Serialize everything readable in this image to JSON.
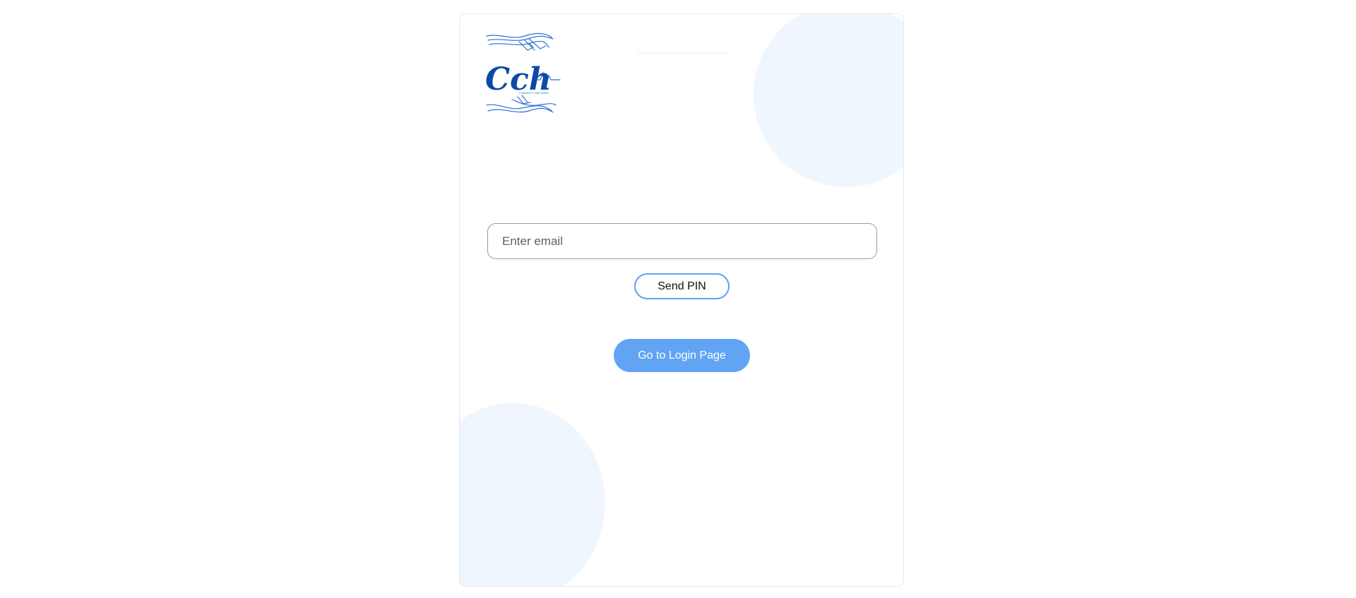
{
  "logo": {
    "text": "Cch",
    "tagline": "COMMUNITY CARE HOMES",
    "color": "#0d49a6",
    "line_color": "#2c6fd6"
  },
  "email": {
    "placeholder": "Enter email",
    "value": ""
  },
  "buttons": {
    "send_pin": "Send PIN",
    "go_to_login": "Go to Login Page"
  },
  "colors": {
    "accent": "#62a4f4",
    "outline_accent": "#5da1f3",
    "decor": "#eff6fe",
    "card_border": "#e3e7ee"
  }
}
